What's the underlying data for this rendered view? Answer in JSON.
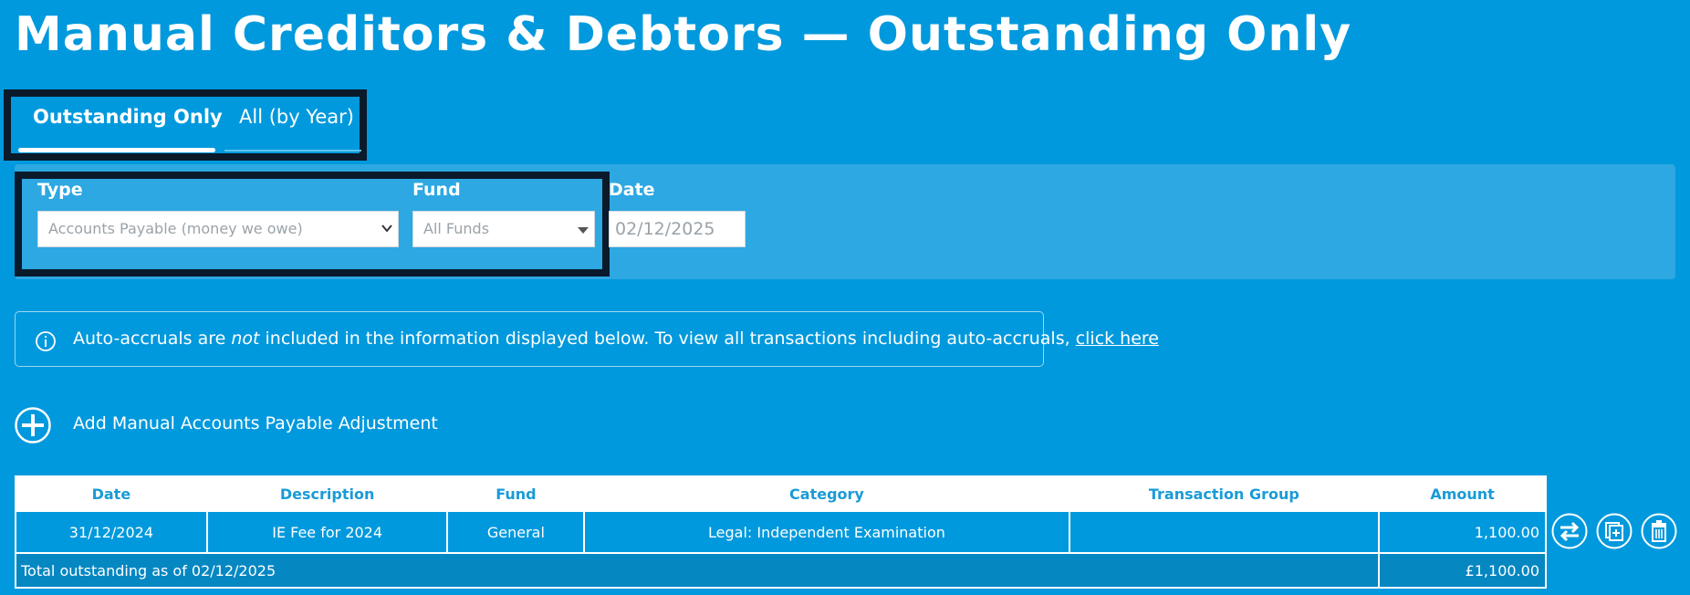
{
  "page": {
    "title": "Manual Creditors & Debtors — Outstanding Only"
  },
  "tabs": [
    {
      "label": "Outstanding Only",
      "active": true
    },
    {
      "label": "All (by Year)",
      "active": false
    }
  ],
  "filters": {
    "type": {
      "label": "Type",
      "value": "Accounts Payable (money we owe)"
    },
    "fund": {
      "label": "Fund",
      "value": "All Funds"
    },
    "date": {
      "label": "Date",
      "value": "02/12/2025"
    }
  },
  "info": {
    "prefix": "Auto-accruals are ",
    "emphasis": "not",
    "suffix": " included in the information displayed below. To view all transactions including auto-accruals, ",
    "link": "click here"
  },
  "add_action": {
    "label": "Add Manual Accounts Payable Adjustment"
  },
  "table": {
    "headers": [
      "Date",
      "Description",
      "Fund",
      "Category",
      "Transaction Group",
      "Amount"
    ],
    "rows": [
      {
        "date": "31/12/2024",
        "description": "IE Fee for 2024",
        "fund": "General",
        "category": "Legal: Independent Examination",
        "transaction_group": "",
        "amount": "1,100.00"
      }
    ],
    "total": {
      "label": "Total outstanding as of 02/12/2025",
      "amount": "£1,100.00"
    }
  },
  "row_actions": [
    {
      "icon": "transfer-icon"
    },
    {
      "icon": "duplicate-icon"
    },
    {
      "icon": "trash-icon"
    }
  ],
  "colors": {
    "background": "#0099dd",
    "panel": "#2da8e2",
    "highlight_border": "#0a1a2b",
    "header_text": "#1a9bd7"
  }
}
